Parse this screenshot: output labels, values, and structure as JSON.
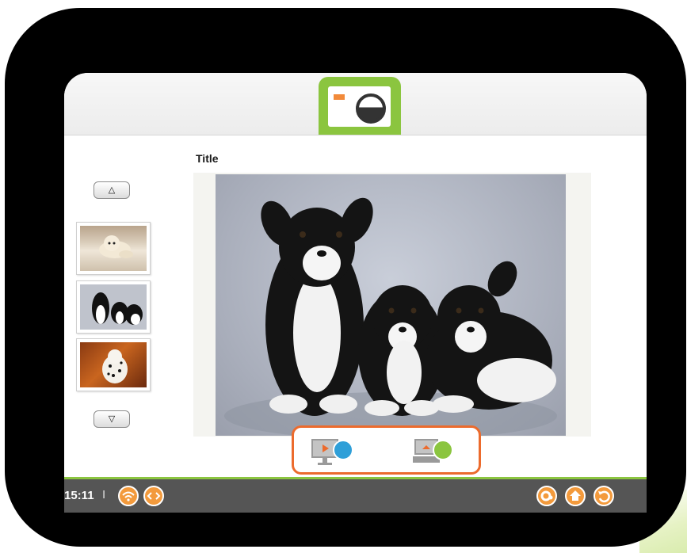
{
  "main": {
    "title": "Title",
    "up_arrow": "△",
    "down_arrow": "▽"
  },
  "thumbnails": [
    {
      "name": "puppy-thumbnail-1"
    },
    {
      "name": "puppy-thumbnail-2"
    },
    {
      "name": "puppy-thumbnail-3"
    }
  ],
  "status_bar": {
    "time": "15:11",
    "separator": "I"
  },
  "icons": {
    "header": "camera-icon",
    "action_1": "screen-play-icon",
    "action_2": "device-connect-icon",
    "status": [
      "wifi-icon",
      "code-icon"
    ],
    "nav": [
      "settings-icon",
      "home-icon",
      "back-icon"
    ]
  },
  "colors": {
    "accent_green": "#8bc53f",
    "accent_orange": "#ec6b2d",
    "button_orange": "#f39a3c",
    "status_bar": "#555555"
  }
}
